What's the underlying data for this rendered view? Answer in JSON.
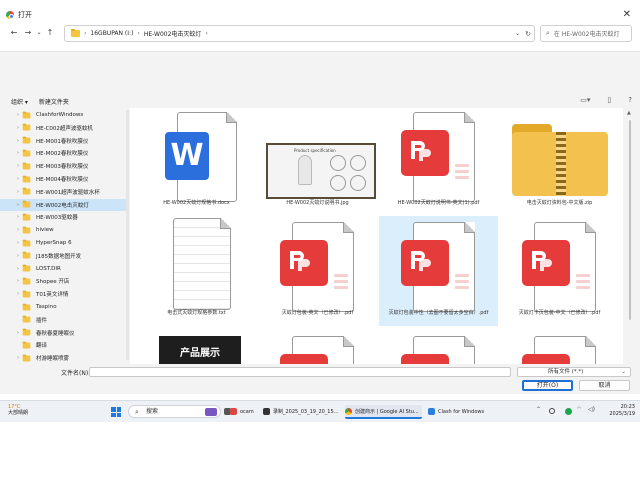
{
  "window": {
    "title": "打开",
    "close_glyph": "✕"
  },
  "nav": {
    "back": "←",
    "forward": "→",
    "up_chevron": "⌄",
    "up": "↑",
    "refresh": "↻",
    "path": [
      "16GBUPAN (I:)",
      "HE-W002电击灭蚊灯"
    ],
    "search_placeholder": "在 HE-W002电击灭蚊灯"
  },
  "toolbar": {
    "organize": "组织 ▾",
    "new_folder": "新建文件夹"
  },
  "sidebar": {
    "items": [
      {
        "label": "ClashforWindows",
        "chev": "›"
      },
      {
        "label": "HE-C002超声波驱蚊机",
        "chev": "›"
      },
      {
        "label": "HE-M001春秋吹膜仪",
        "chev": "›"
      },
      {
        "label": "HE-M002春秋吹膜仪",
        "chev": "›"
      },
      {
        "label": "HE-M003春秋吹膜仪",
        "chev": "›"
      },
      {
        "label": "HE-M004春秋吹膜仪",
        "chev": "›"
      },
      {
        "label": "HE-W001超声波驱蚊水杯",
        "chev": "›"
      },
      {
        "label": "HE-W002电击灭蚊灯",
        "chev": "›"
      },
      {
        "label": "HE-W003驱蚊器",
        "chev": "›"
      },
      {
        "label": "hiview",
        "chev": "›"
      },
      {
        "label": "HyperSnap 6",
        "chev": "›"
      },
      {
        "label": "J185数据地图开发",
        "chev": "›"
      },
      {
        "label": "LOST.DIR",
        "chev": "›"
      },
      {
        "label": "Shopee 开店",
        "chev": "›"
      },
      {
        "label": "T01英文详情",
        "chev": "›"
      },
      {
        "label": "Taspino",
        "chev": ""
      },
      {
        "label": "插件",
        "chev": ""
      },
      {
        "label": "春秋春夏睡眠仪",
        "chev": "›"
      },
      {
        "label": "翻译",
        "chev": ""
      },
      {
        "label": "村游睡眠喷雾",
        "chev": "›"
      }
    ]
  },
  "files": [
    {
      "name": "HE-W002灭蚊灯规格书.docx",
      "kind": "word"
    },
    {
      "name": "HE-W002灭蚊灯说明书.jpg",
      "kind": "image",
      "thumb_title": "Product specification"
    },
    {
      "name": "HE-W002灭蚊灯说明书-英文(1).pdf",
      "kind": "pdf"
    },
    {
      "name": "电击灭蚊灯资料包-中文版.zip",
      "kind": "zip"
    },
    {
      "name": "电击式灭蚊灯规格参数.txt",
      "kind": "txt"
    },
    {
      "name": "灭蚊灯包装-英文（已修改）.pdf",
      "kind": "pdf"
    },
    {
      "name": "灭蚊灯包装中性（去图不要留太多空白）.pdf",
      "kind": "pdf"
    },
    {
      "name": "灭蚊灯卡页包装-中文（已修改）.pdf",
      "kind": "pdf"
    },
    {
      "name": "产品展示",
      "kind": "video-thumb",
      "thumb_text": "产品展示"
    },
    {
      "name": "",
      "kind": "pdf"
    },
    {
      "name": "",
      "kind": "pdf"
    },
    {
      "name": "",
      "kind": "pdf"
    }
  ],
  "bottom": {
    "filename_label": "文件名(N):",
    "filetype": "所有文件 (*.*)",
    "open": "打开(O)",
    "cancel": "取消"
  },
  "taskbar": {
    "weather_temp": "17°C",
    "weather_desc": "大部晴朗",
    "search": "搜索",
    "tasks": [
      "ocam",
      "录制_2025_03_19_20_15...",
      "创建商示 | Google AI Stu...",
      "Clash for Windows"
    ],
    "time": "20:23",
    "date": "2025/3/19"
  },
  "colors": {
    "accent": "#1f7ae0",
    "pdf_red": "#e53b3b",
    "word_blue": "#2b6fdc",
    "zip_yellow": "#f2c14e",
    "selection": "#cce4f7"
  }
}
